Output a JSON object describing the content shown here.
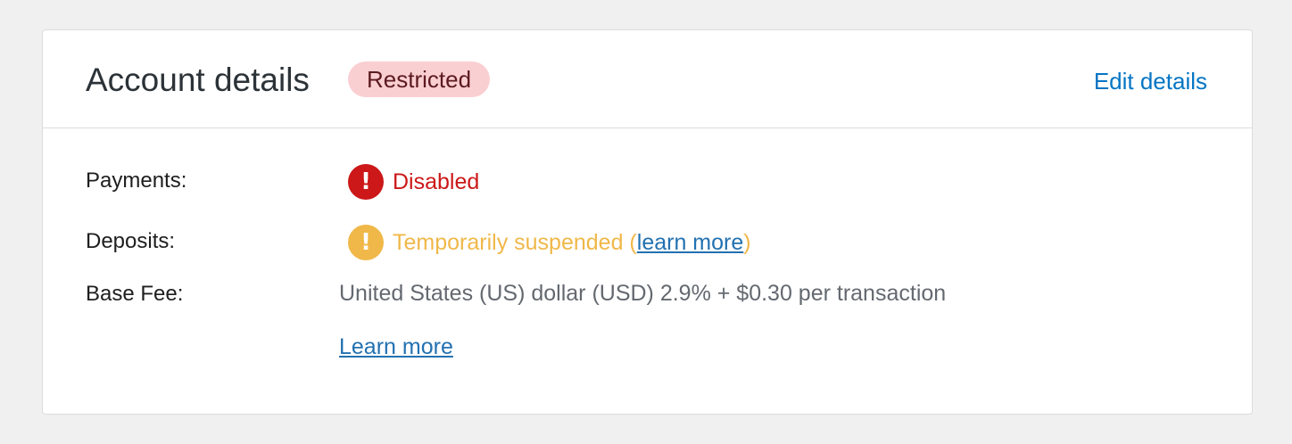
{
  "card": {
    "title": "Account details",
    "status_badge": "Restricted",
    "edit_link": "Edit details"
  },
  "rows": {
    "payments": {
      "label": "Payments:",
      "icon": "error-exclamation-icon",
      "icon_glyph": "!",
      "value": "Disabled",
      "color": "#cc1818"
    },
    "deposits": {
      "label": "Deposits:",
      "icon": "warning-exclamation-icon",
      "icon_glyph": "!",
      "value": "Temporarily suspended",
      "paren_open": " (",
      "link": "learn more",
      "paren_close": ")",
      "color": "#f0b849"
    },
    "base_fee": {
      "label": "Base Fee:",
      "value": "United States (US) dollar (USD) 2.9% + $0.30 per transaction",
      "link": "Learn more"
    }
  },
  "colors": {
    "link": "#2271b1",
    "badge_background": "#facfd2",
    "page_background": "#f0f0f1"
  }
}
